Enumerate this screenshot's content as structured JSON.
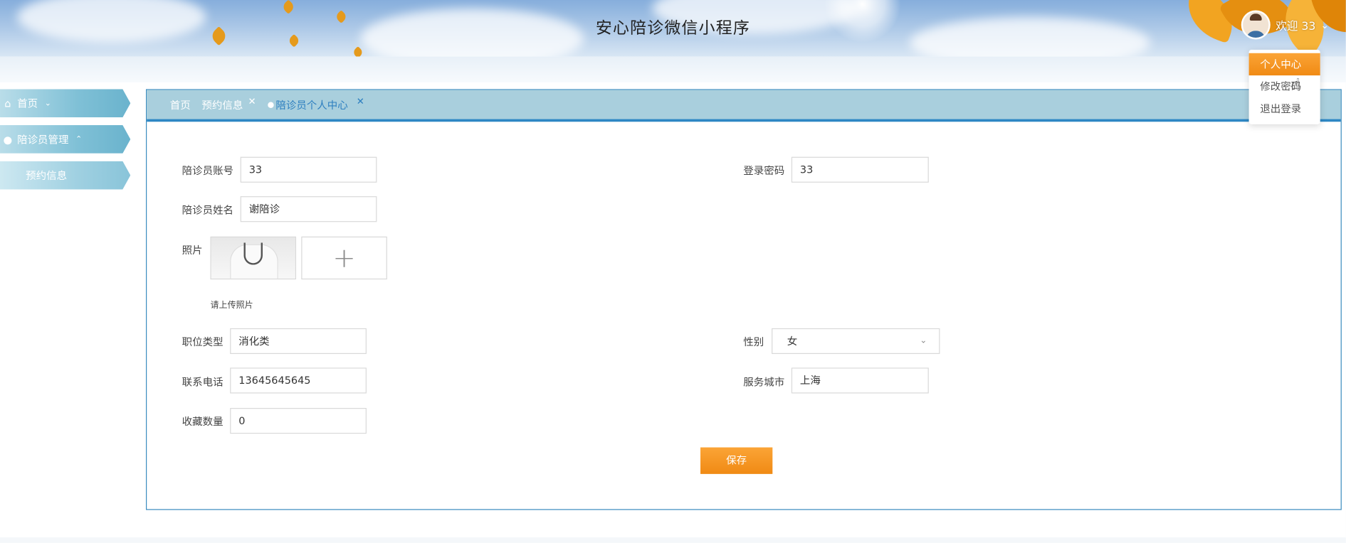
{
  "header": {
    "app_title": "安心陪诊微信小程序",
    "welcome": "欢迎 33",
    "chevron_icon": "chevron-down-icon"
  },
  "user_menu": {
    "items": [
      "个人中心",
      "修改密码",
      "退出登录"
    ],
    "active_index": 0
  },
  "sidebar": {
    "items": [
      {
        "label": "首页",
        "icon": "home-icon"
      },
      {
        "label": "陪诊员管理",
        "icon": "user-icon"
      },
      {
        "label": "预约信息",
        "icon": ""
      }
    ]
  },
  "tabs": {
    "items": [
      {
        "label": "首页"
      },
      {
        "label": "预约信息"
      },
      {
        "label": "陪诊员个人中心"
      }
    ]
  },
  "form": {
    "account_label": "陪诊员账号",
    "account_value": "33",
    "password_label": "登录密码",
    "password_value": "33",
    "name_label": "陪诊员姓名",
    "name_value": "谢陪诊",
    "photo_label": "照片",
    "photo_hint": "请上传照片",
    "position_label": "职位类型",
    "position_value": "消化类",
    "gender_label": "性别",
    "gender_value": "女",
    "phone_label": "联系电话",
    "phone_value": "13645645645",
    "city_label": "服务城市",
    "city_value": "上海",
    "favorites_label": "收藏数量",
    "favorites_value": "0",
    "save_label": "保存"
  },
  "colors": {
    "accent_orange": "#f7941d",
    "tab_active": "#2d7fc0",
    "panel_border": "#3a8bbf",
    "tabbar_bg": "#a9cfdd"
  }
}
